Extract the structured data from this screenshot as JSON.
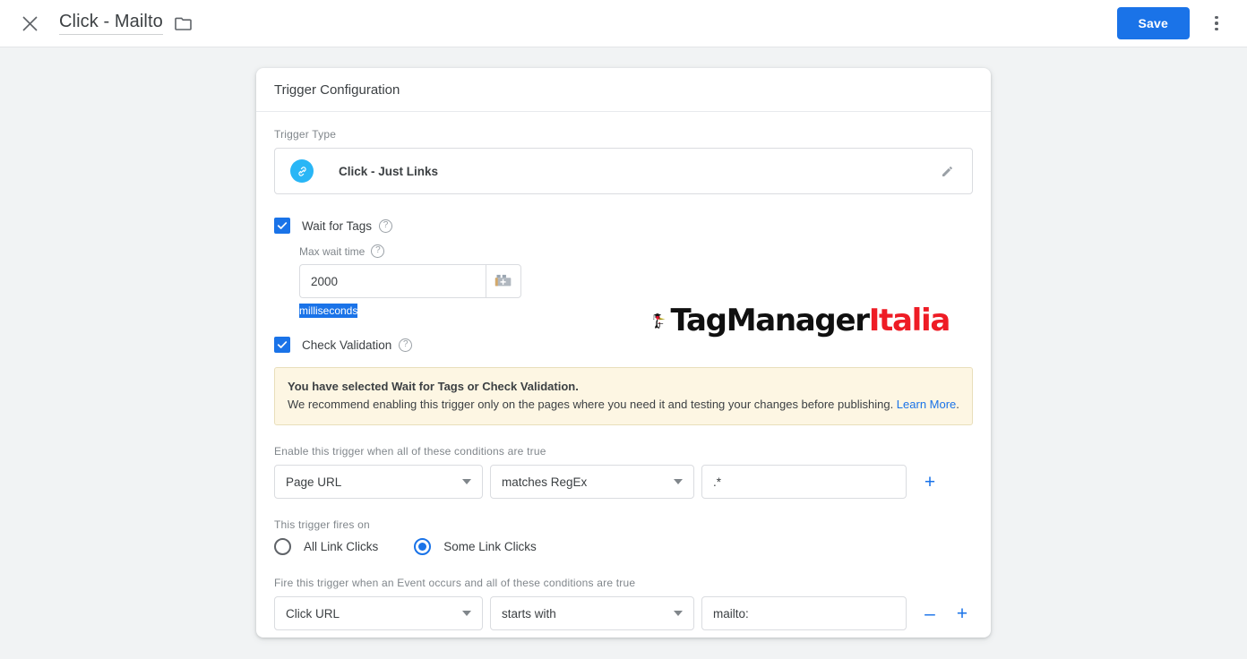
{
  "topbar": {
    "close_icon": "close-icon",
    "title": "Click - Mailto",
    "folder_icon": "folder-icon",
    "save_label": "Save",
    "kebab_icon": "more-options-icon"
  },
  "card": {
    "header_title": "Trigger Configuration",
    "trigger_type": {
      "label": "Trigger Type",
      "icon": "link-icon",
      "value": "Click - Just Links",
      "edit_icon": "pencil-icon"
    },
    "wait_for_tags": {
      "label": "Wait for Tags",
      "checked": true,
      "help_icon": "help-icon",
      "max_wait_label": "Max wait time",
      "max_wait_help_icon": "help-icon",
      "max_wait_value": "2000",
      "variable_picker_icon": "insert-variable-icon",
      "unit": "milliseconds"
    },
    "check_validation": {
      "label": "Check Validation",
      "checked": true,
      "help_icon": "help-icon"
    },
    "warning": {
      "title": "You have selected Wait for Tags or Check Validation.",
      "body": "We recommend enabling this trigger only on the pages where you need it and testing your changes before publishing. ",
      "link_text": "Learn More",
      "link_suffix": ".",
      "bg_color": "#fdf6e3",
      "border_color": "#e9dfbb"
    },
    "enable_conditions": {
      "label": "Enable this trigger when all of these conditions are true",
      "variable": "Page URL",
      "operator": "matches RegEx",
      "value": ".*",
      "add_label": "+"
    },
    "fires_on": {
      "label": "This trigger fires on",
      "options": [
        {
          "label": "All Link Clicks",
          "selected": false
        },
        {
          "label": "Some Link Clicks",
          "selected": true
        }
      ]
    },
    "fire_conditions": {
      "label": "Fire this trigger when an Event occurs and all of these conditions are true",
      "variable": "Click URL",
      "operator": "starts with",
      "value": "mailto:",
      "remove_label": "–",
      "add_label": "+"
    }
  },
  "watermark": {
    "mascot": "woodpecker-graduate-icon",
    "text_black": "TagManager",
    "text_red": "Italia",
    "red_hex": "#ee1c25"
  }
}
